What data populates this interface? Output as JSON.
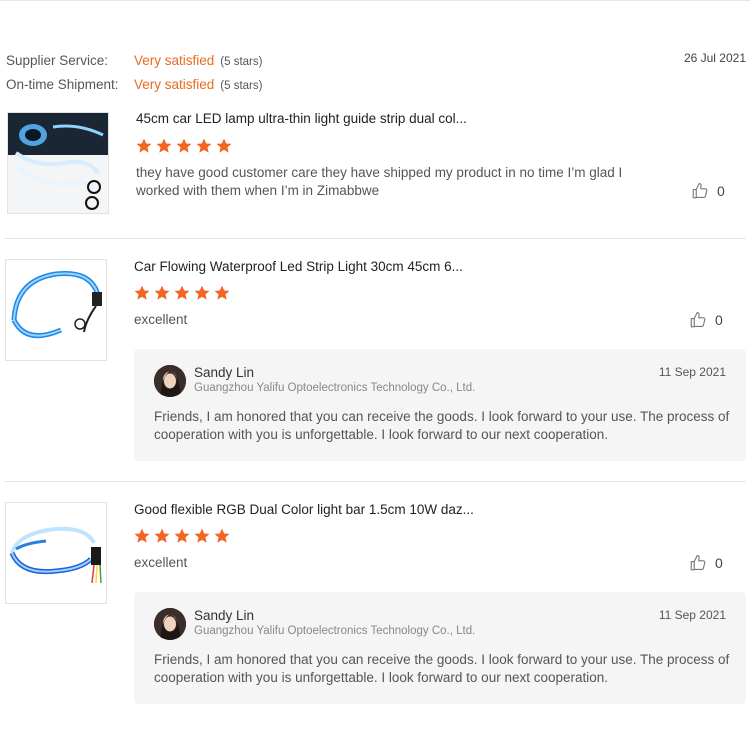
{
  "header": {
    "supplier_label": "Supplier Service:",
    "supplier_value": "Very satisfied",
    "supplier_stars": "(5 stars)",
    "shipment_label": "On-time Shipment:",
    "shipment_value": "Very satisfied",
    "shipment_stars": "(5 stars)",
    "date": "26 Jul 2021"
  },
  "reviews": [
    {
      "title": "45cm car LED lamp ultra-thin light guide strip dual col...",
      "rating": 5,
      "text": "they have good customer care they have shipped my product in no time I’m glad I worked with them when I’m in Zimabbwe",
      "likes": "0"
    },
    {
      "title": "Car Flowing Waterproof Led Strip Light 30cm 45cm 6...",
      "rating": 5,
      "text": "excellent",
      "likes": "0",
      "reply": {
        "name": "Sandy Lin",
        "company": "Guangzhou Yalifu Optoelectronics Technology Co., Ltd.",
        "date": "11 Sep 2021",
        "text": "Friends, I am honored that you can receive the goods. I look forward to your use. The process of cooperation with you is unforgettable. I look forward to our next cooperation."
      }
    },
    {
      "title": "Good flexible RGB Dual Color light bar 1.5cm 10W daz...",
      "rating": 5,
      "text": "excellent",
      "likes": "0",
      "reply": {
        "name": "Sandy Lin",
        "company": "Guangzhou Yalifu Optoelectronics Technology Co., Ltd.",
        "date": "11 Sep 2021",
        "text": "Friends, I am honored that you can receive the goods. I look forward to your use. The process of cooperation with you is unforgettable. I look forward to our next cooperation."
      }
    }
  ],
  "colors": {
    "accent": "#e96a1d",
    "star": "#f26522",
    "reply_bg": "#f5f5f5"
  }
}
